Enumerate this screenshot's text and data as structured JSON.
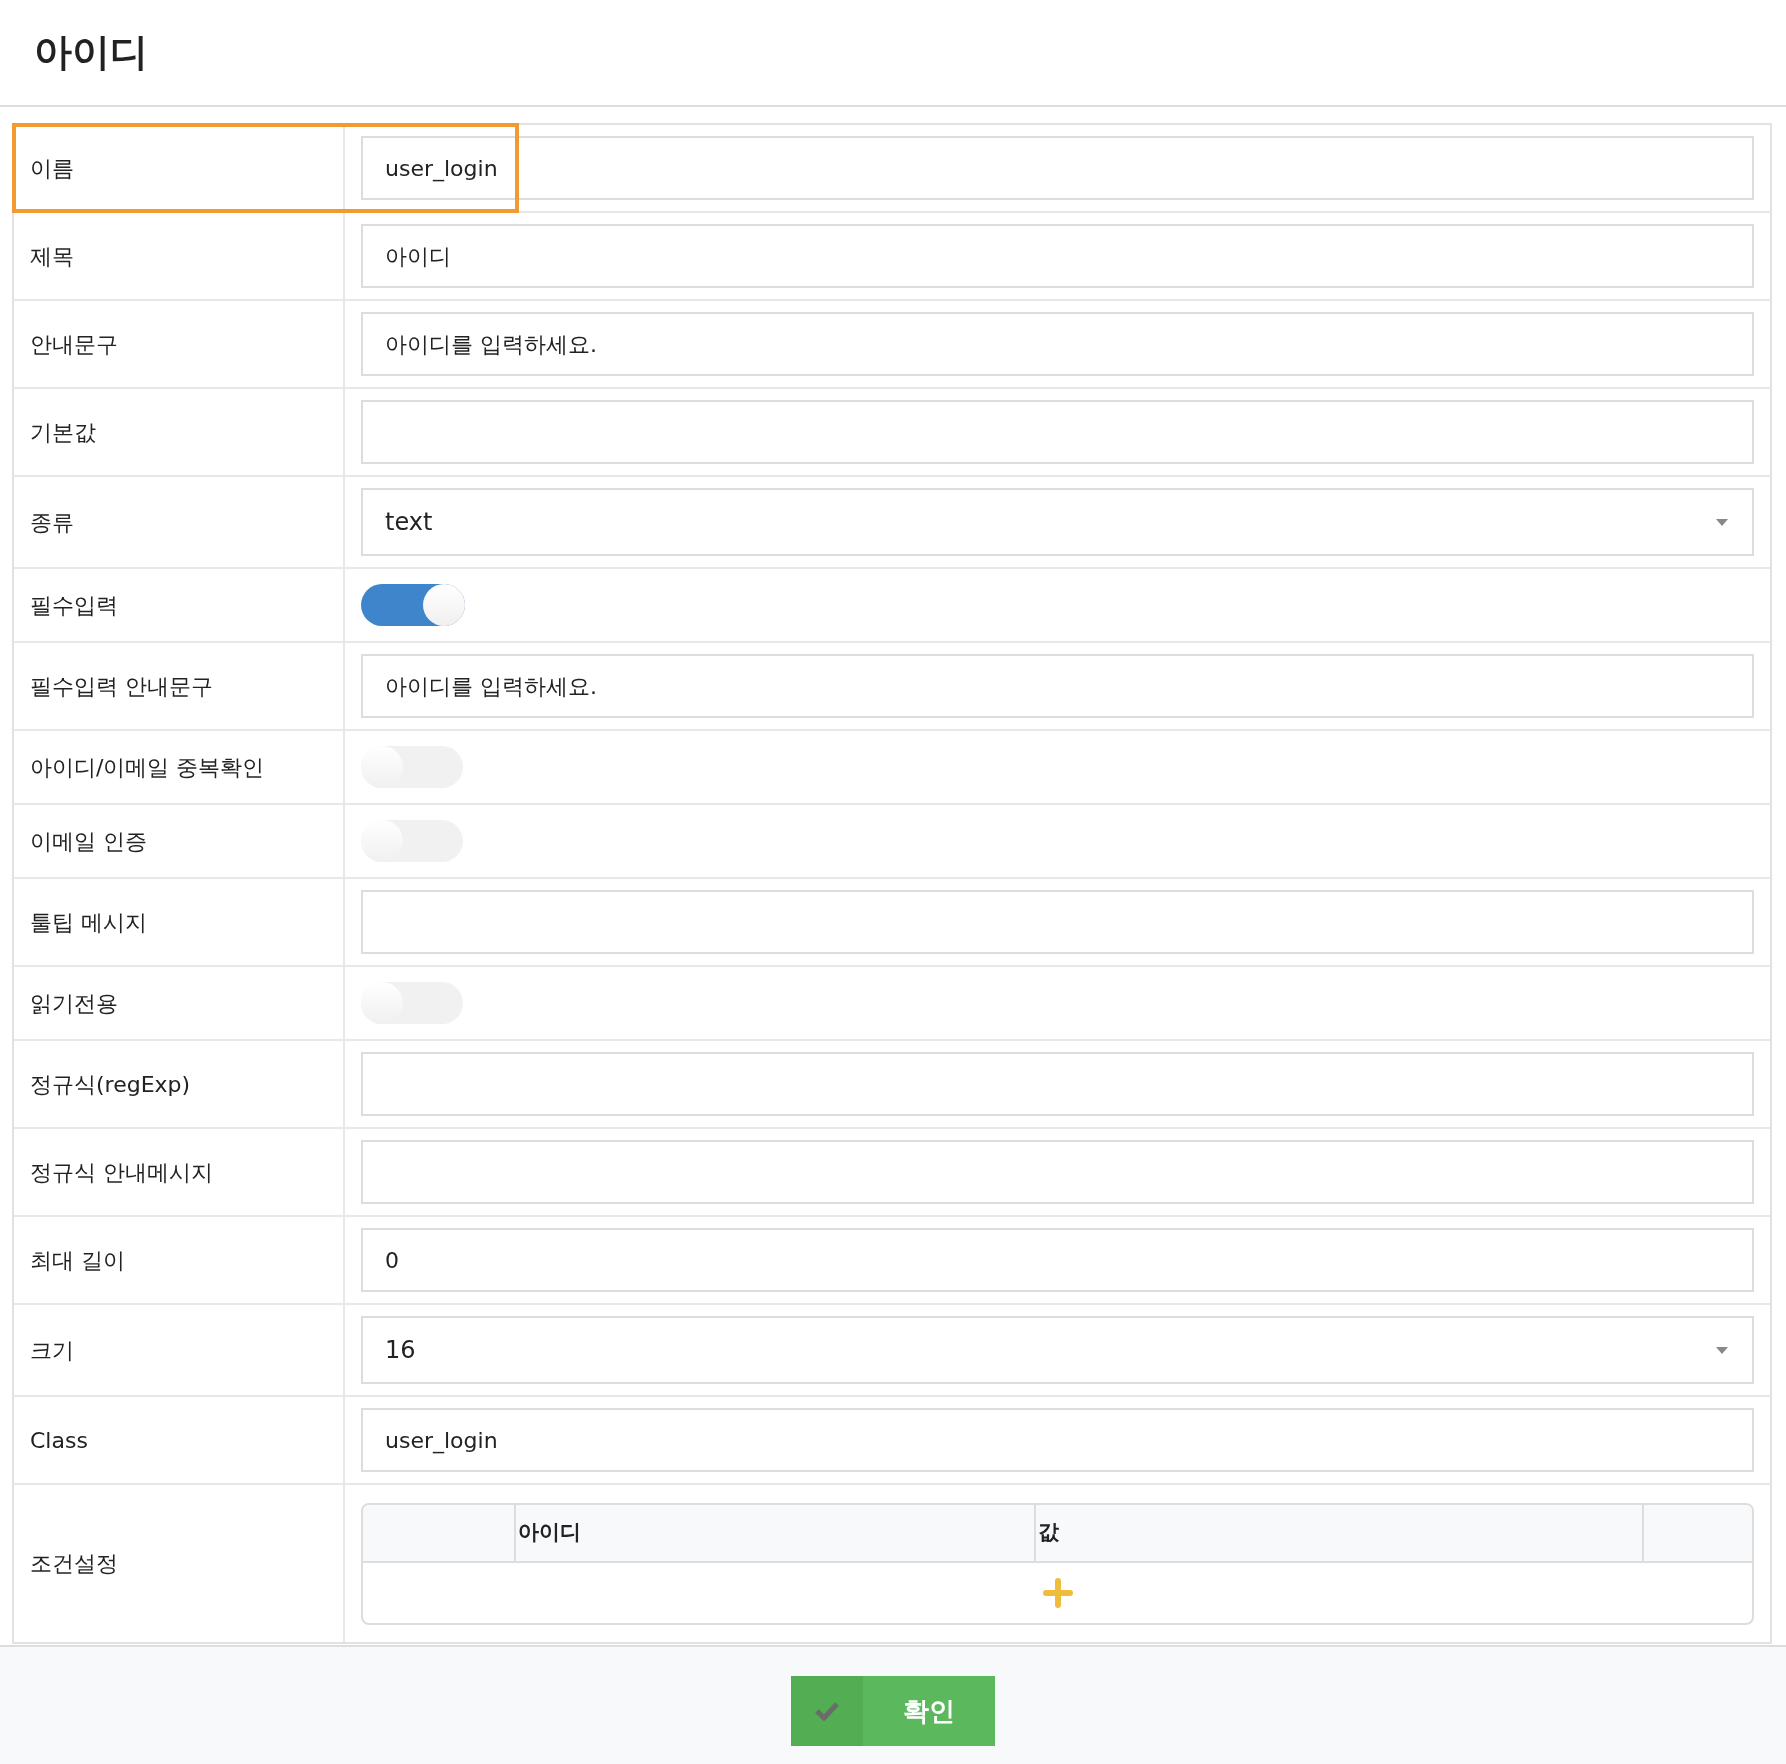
{
  "header": {
    "title": "아이디"
  },
  "fields": [
    {
      "kind": "text",
      "label": "이름",
      "value": "user_login",
      "highlighted": true
    },
    {
      "kind": "text",
      "label": "제목",
      "value": "아이디",
      "highlighted": false
    },
    {
      "kind": "text",
      "label": "안내문구",
      "value": "아이디를 입력하세요.",
      "highlighted": false
    },
    {
      "kind": "text",
      "label": "기본값",
      "highlighted": false
    },
    {
      "kind": "select",
      "label": "종류",
      "value": "text",
      "highlighted": false
    },
    {
      "kind": "toggle",
      "label": "필수입력",
      "on": true,
      "highlighted": false
    },
    {
      "kind": "text",
      "label": "필수입력 안내문구",
      "value": "아이디를 입력하세요.",
      "highlighted": false
    },
    {
      "kind": "toggle",
      "label": "아이디/이메일 중복확인",
      "on": false,
      "highlighted": false
    },
    {
      "kind": "toggle",
      "label": "이메일 인증",
      "on": false,
      "highlighted": false
    },
    {
      "kind": "text",
      "label": "툴팁 메시지",
      "highlighted": false
    },
    {
      "kind": "toggle",
      "label": "읽기전용",
      "on": false,
      "highlighted": false
    },
    {
      "kind": "text",
      "label": "정규식(regExp)",
      "highlighted": false
    },
    {
      "kind": "text",
      "label": "정규식 안내메시지",
      "highlighted": false
    },
    {
      "kind": "text",
      "label": "최대 길이",
      "value": "0",
      "highlighted": false
    },
    {
      "kind": "select",
      "label": "크기",
      "value": "16",
      "highlighted": false
    },
    {
      "kind": "text",
      "label": "Class",
      "value": "user_login",
      "highlighted": false
    },
    {
      "kind": "conditions",
      "label": "조건설정",
      "columns": [
        "아이디",
        "값"
      ],
      "highlighted": false
    }
  ],
  "footer": {
    "confirm_button": "확인"
  }
}
